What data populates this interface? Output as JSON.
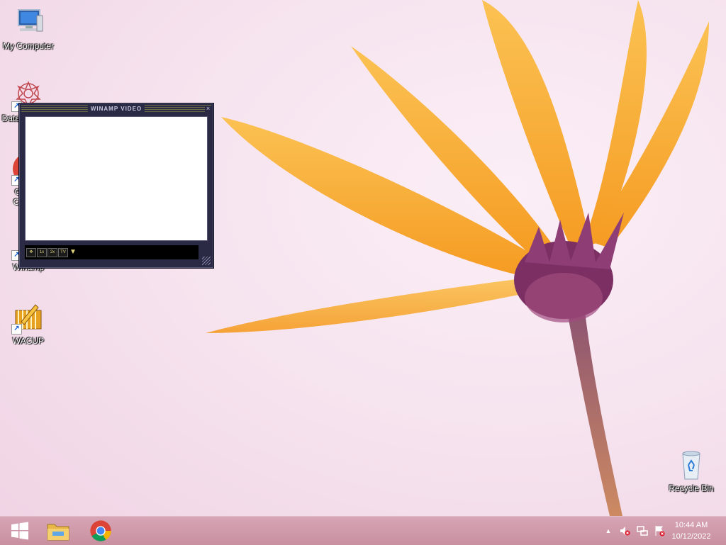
{
  "desktop": {
    "icons": [
      {
        "label": "My Computer",
        "icon": "computer-icon"
      },
      {
        "label": "DataDragon...",
        "icon": "datadragon-icon"
      },
      {
        "label": "Google Chrome",
        "icon": "chrome-icon"
      },
      {
        "label": "Winamp",
        "icon": "winamp-icon"
      },
      {
        "label": "WACUP",
        "icon": "wacup-icon"
      },
      {
        "label": "Recycle Bin",
        "icon": "recycle-bin-icon"
      }
    ]
  },
  "winamp_video": {
    "title": "WINAMP VIDEO",
    "close_glyph": "×",
    "buttons": [
      {
        "label": "✥",
        "icon": "fullscreen-icon"
      },
      {
        "label": "1x",
        "icon": "zoom-1x-icon"
      },
      {
        "label": "2x",
        "icon": "zoom-2x-icon"
      },
      {
        "label": "TV",
        "icon": "tv-icon"
      },
      {
        "label": "▼",
        "icon": "menu-arrow-icon"
      }
    ]
  },
  "taskbar": {
    "pinned": [
      "start-icon",
      "file-explorer-icon",
      "chrome-icon"
    ],
    "tray": [
      "show-hidden-icons-icon",
      "volume-muted-icon",
      "network-icon",
      "action-center-icon"
    ],
    "clock": {
      "time": "10:44 AM",
      "date": "10/12/2022"
    }
  },
  "colors": {
    "taskbar": "#c9909f",
    "winamp_frame": "#2a2a44",
    "petal": "#f6a531"
  }
}
